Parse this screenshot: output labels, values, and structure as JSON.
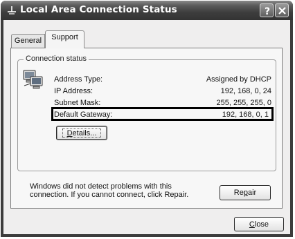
{
  "window": {
    "title": "Local Area Connection Status"
  },
  "title_buttons": {
    "help_glyph": "?",
    "close_glyph": "✕"
  },
  "tabs": [
    {
      "label": "General",
      "selected": false
    },
    {
      "label": "Support",
      "selected": true
    }
  ],
  "group": {
    "legend": "Connection status"
  },
  "details": [
    {
      "label": "Address Type:",
      "value": "Assigned by DHCP"
    },
    {
      "label": "IP Address:",
      "value": "192, 168, 0, 24"
    },
    {
      "label": "Subnet Mask:",
      "value": "255, 255, 255, 0"
    },
    {
      "label": "Default Gateway:",
      "value": "192, 168, 0, 1",
      "highlighted": true
    }
  ],
  "buttons": {
    "details": {
      "pre": "",
      "key": "D",
      "post": "etails..."
    },
    "repair": {
      "pre": "Re",
      "key": "p",
      "post": "air"
    },
    "close": {
      "pre": "",
      "key": "C",
      "post": "lose"
    }
  },
  "note": "Windows did not detect problems with this connection. If you cannot connect, click Repair.",
  "colors": {
    "titlebar": "#3d3d3d",
    "title_text": "#ffffff",
    "dialog_face": "#efeeee",
    "highlight_border": "#000000"
  }
}
